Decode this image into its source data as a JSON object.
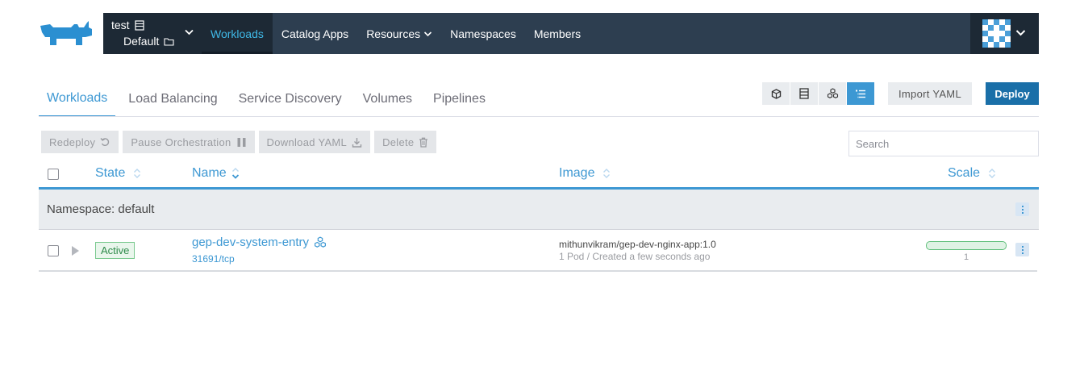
{
  "header": {
    "cluster_name": "test",
    "project_name": "Default",
    "nav": [
      {
        "label": "Workloads"
      },
      {
        "label": "Catalog Apps"
      },
      {
        "label": "Resources"
      },
      {
        "label": "Namespaces"
      },
      {
        "label": "Members"
      }
    ]
  },
  "tabs": [
    {
      "label": "Workloads"
    },
    {
      "label": "Load Balancing"
    },
    {
      "label": "Service Discovery"
    },
    {
      "label": "Volumes"
    },
    {
      "label": "Pipelines"
    }
  ],
  "toolbar": {
    "view_icons": [
      "cube-icon",
      "list-stack-icon",
      "cubes-icon",
      "tree-list-icon"
    ],
    "import_label": "Import YAML",
    "deploy_label": "Deploy"
  },
  "bulk_actions": {
    "redeploy": "Redeploy",
    "pause": "Pause Orchestration",
    "download": "Download YAML",
    "delete": "Delete"
  },
  "search": {
    "placeholder": "Search"
  },
  "table": {
    "columns": {
      "state": "State",
      "name": "Name",
      "image": "Image",
      "scale": "Scale"
    },
    "group_label": "Namespace: default",
    "rows": [
      {
        "state": "Active",
        "name": "gep-dev-system-entry",
        "port": "31691/tcp",
        "image": "mithunvikram/gep-dev-nginx-app:1.0",
        "image_detail": "1 Pod / Created a few seconds ago",
        "scale": "1",
        "scale_fraction": 1.0
      }
    ]
  },
  "colors": {
    "accent": "#3d98d3",
    "topbar": "#2d3e50",
    "active_green": "#2e8b4a"
  }
}
